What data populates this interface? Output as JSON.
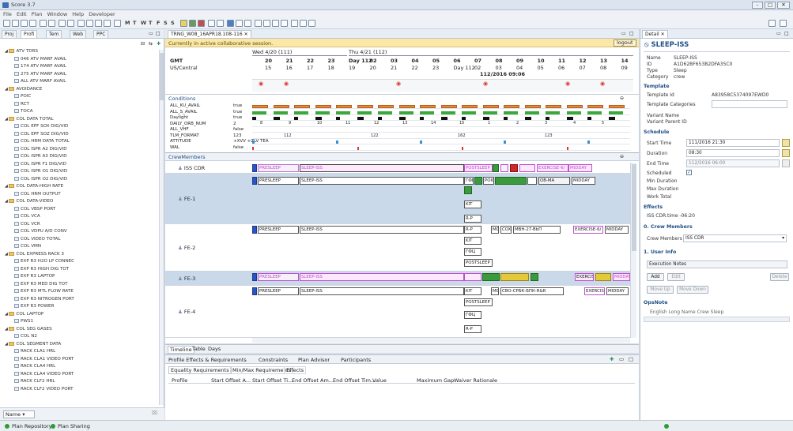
{
  "app": {
    "title": "Score 3.7",
    "menus": [
      "File",
      "Edit",
      "Plan",
      "Window",
      "Help",
      "Developer"
    ],
    "week_days": [
      "M",
      "T",
      "W",
      "T",
      "F",
      "S",
      "S"
    ]
  },
  "nav_tabs": [
    "Proj",
    "Profi",
    "Tem",
    "Web",
    "PPC"
  ],
  "tree": [
    {
      "label": "ATV TDRS",
      "type": "folder",
      "indent": 0
    },
    {
      "label": "046 ATV MARF AVAIL",
      "indent": 1
    },
    {
      "label": "174 ATV MARF AVAIL",
      "indent": 1
    },
    {
      "label": "275 ATV MARF AVAIL",
      "indent": 1
    },
    {
      "label": "ALL ATV MARF AVAIL",
      "indent": 1
    },
    {
      "label": "AVOIDANCE",
      "type": "folder",
      "indent": 0
    },
    {
      "label": "POIC",
      "indent": 1
    },
    {
      "label": "RCT",
      "indent": 1
    },
    {
      "label": "TOCA",
      "indent": 1
    },
    {
      "label": "COL DATA TOTAL",
      "type": "folder",
      "indent": 0
    },
    {
      "label": "COL EPF SOX DIG/VID",
      "indent": 1
    },
    {
      "label": "COL EPF SOZ DIG/VID",
      "indent": 1
    },
    {
      "label": "COL HRM DATA TOTAL",
      "indent": 1
    },
    {
      "label": "COL ISPR A2 DIG/VID",
      "indent": 1
    },
    {
      "label": "COL ISPR A3 DIG/VID",
      "indent": 1
    },
    {
      "label": "COL ISPR F1 DIG/VID",
      "indent": 1
    },
    {
      "label": "COL ISPR O1 DIG/VID",
      "indent": 1
    },
    {
      "label": "COL ISPR O2 DIG/VID",
      "indent": 1
    },
    {
      "label": "COL DATA-HIGH RATE",
      "type": "folder",
      "indent": 0
    },
    {
      "label": "COL HRM OUTPUT",
      "indent": 1
    },
    {
      "label": "COL DATA-VIDEO",
      "type": "folder",
      "indent": 0
    },
    {
      "label": "COL VBSP PORT",
      "indent": 1
    },
    {
      "label": "COL VCA",
      "indent": 1
    },
    {
      "label": "COL VCR",
      "indent": 1
    },
    {
      "label": "COL VDPU A/D CONV",
      "indent": 1
    },
    {
      "label": "COL VIDEO TOTAL",
      "indent": 1
    },
    {
      "label": "COL VMN",
      "indent": 1
    },
    {
      "label": "COL EXPRESS RACK 3",
      "type": "folder",
      "indent": 0
    },
    {
      "label": "EXP R3 H2O LP CONNEC",
      "indent": 1
    },
    {
      "label": "EXP R3 HIGH DIG TOT",
      "indent": 1
    },
    {
      "label": "EXP R3 LAPTOP",
      "indent": 1
    },
    {
      "label": "EXP R3 MED DIG TOT",
      "indent": 1
    },
    {
      "label": "EXP R3 MTL FLOW RATE",
      "indent": 1
    },
    {
      "label": "EXP R3 NITROGEN PORT",
      "indent": 1
    },
    {
      "label": "EXP R3 POWER",
      "indent": 1
    },
    {
      "label": "COL LAPTOP",
      "type": "folder",
      "indent": 0
    },
    {
      "label": "PWS1",
      "indent": 1
    },
    {
      "label": "COL SEG GASES",
      "type": "folder",
      "indent": 0
    },
    {
      "label": "COL N2",
      "indent": 1
    },
    {
      "label": "COL SEGMENT DATA",
      "type": "folder",
      "indent": 0
    },
    {
      "label": "RACK CLA1 HRL",
      "indent": 1
    },
    {
      "label": "RACK CLA1 VIDEO PORT",
      "indent": 1
    },
    {
      "label": "RACK CLA4 HRL",
      "indent": 1
    },
    {
      "label": "RACK CLA4 VIDEO PORT",
      "indent": 1
    },
    {
      "label": "RACK CLF2 HRL",
      "indent": 1
    },
    {
      "label": "RACK CLF2 VIDEO PORT",
      "indent": 1
    }
  ],
  "name_filter": "Name",
  "status": {
    "repo": "Plan Repository",
    "sharing": "Plan Sharing"
  },
  "editor_tab": "TRNG_W08_16APR18.108-116",
  "collab_text": "Currently in active collaborative session.",
  "logout": "logout",
  "timeline": {
    "zone_gmt": "GMT",
    "zone_us": "US/Central",
    "days": [
      {
        "label": "Wed 4/20 (111)"
      },
      {
        "label": "Thu 4/21 (112)"
      }
    ],
    "gmt_hours": [
      "20",
      "21",
      "22",
      "23",
      "Day 112",
      "02",
      "03",
      "04",
      "05",
      "06",
      "07",
      "08",
      "09",
      "10",
      "11",
      "12",
      "13",
      "14"
    ],
    "us_hours": [
      "15",
      "16",
      "17",
      "18",
      "19",
      "20",
      "21",
      "22",
      "23",
      "Day 112",
      "02",
      "03",
      "04",
      "05",
      "06",
      "07",
      "08",
      "09"
    ],
    "cursor_time": "112/2016 09:06"
  },
  "conditions": {
    "title": "Conditions",
    "rows": [
      {
        "name": "ALL_KU_AVAIL",
        "value": "true"
      },
      {
        "name": "ALL_S_AVAIL",
        "value": "true"
      },
      {
        "name": "Daylight",
        "value": "true"
      },
      {
        "name": "DAILY_ORB_NUM",
        "value": "2"
      },
      {
        "name": "ALL_VHF",
        "value": "false"
      },
      {
        "name": "TLM_FORMAT",
        "value": "123"
      },
      {
        "name": "ATTITUDE",
        "value": "+XVV +ZLV TEA"
      },
      {
        "name": "WAL",
        "value": "false"
      }
    ],
    "orbit_nums": [
      "8",
      "9",
      "10",
      "11",
      "12",
      "13",
      "14",
      "15",
      "1",
      "2",
      "3",
      "4",
      "5"
    ],
    "tlm_vals": [
      "112",
      "122",
      "162",
      "123"
    ],
    "attitude_val": "+XVV +ZLV TEA"
  },
  "crew": {
    "title": "CrewMembers",
    "members": [
      {
        "name": "ISS CDR"
      },
      {
        "name": "FE-1"
      },
      {
        "name": "FE-2"
      },
      {
        "name": "FE-3"
      },
      {
        "name": "FE-4"
      }
    ],
    "labels": {
      "presleep": "PRESLEEP",
      "sleep": "SLEEP-ISS",
      "postsleep": "POSTSLEEP",
      "exercise": "EXERCISE-6/",
      "midday": "MIDDAY",
      "poic": "POIC",
      "kit": "KIT",
      "rp": "R-P",
      "mbn": "MBH-27-BbП",
      "fo": "ГФЦ",
      "mc": "MC",
      "cox": "COX",
      "cbo": "CBO-СРБК-БПК-R&R",
      "exp": "EXERCIS",
      "ob": "OB-MA"
    }
  },
  "view_tabs": [
    "Timeline",
    "Table",
    "Days"
  ],
  "bottom_tabs": [
    "Profile Effects & Requirements",
    "Constraints",
    "Plan Advisor",
    "Participants"
  ],
  "req_tabs": [
    "Equality Requirements",
    "Min/Max Requirements",
    "Effects"
  ],
  "profile_cols": [
    "Profile",
    "Start Offset A...",
    "Start Offset Ti...",
    "End Offset Am...",
    "End Offset Tim...",
    "Value",
    "Maximum Gap",
    "Waiver Rationale"
  ],
  "detail": {
    "tab": "Detail",
    "title": "SLEEP-ISS",
    "name": "SLEEP-ISS",
    "id": "A1D62BF653B2DFA35C0",
    "type": "Sleep",
    "category": "crew",
    "template_section": "Template",
    "template_id": "A83958C5374097EWD0",
    "template_categories_lbl": "Template Categories",
    "variant_name": "Variant Name",
    "variant_parent": "Variant Parent ID",
    "schedule_section": "Schedule",
    "start_time": "111/2016 21:30",
    "duration": "08:30",
    "end_time": "112/2016 06:00",
    "scheduled_lbl": "Scheduled",
    "min_duration": "Min Duration",
    "max_duration": "Max Duration",
    "work_total": "Work Total",
    "effects_section": "Effects",
    "effects_value": "ISS CDR.time -06:20",
    "crew_section": "0. Crew Members",
    "crew_members_lbl": "Crew Members",
    "crew_members_val": "ISS CDR",
    "userinfo_section": "1. User Info",
    "exec_notes": "Execution Notes",
    "add": "Add",
    "edit": "Edit",
    "delete": "Delete",
    "move_up": "Move Up",
    "move_down": "Move Down",
    "opnote_section": "OpsNote",
    "opnote_cols": "English Long Name    Crew Sleep"
  },
  "labels": {
    "name_lbl": "Name",
    "id_lbl": "ID",
    "type_lbl": "Type",
    "category_lbl": "Category",
    "template_id_lbl": "Template Id",
    "start_lbl": "Start Time",
    "duration_lbl": "Duration",
    "end_lbl": "End Time"
  }
}
